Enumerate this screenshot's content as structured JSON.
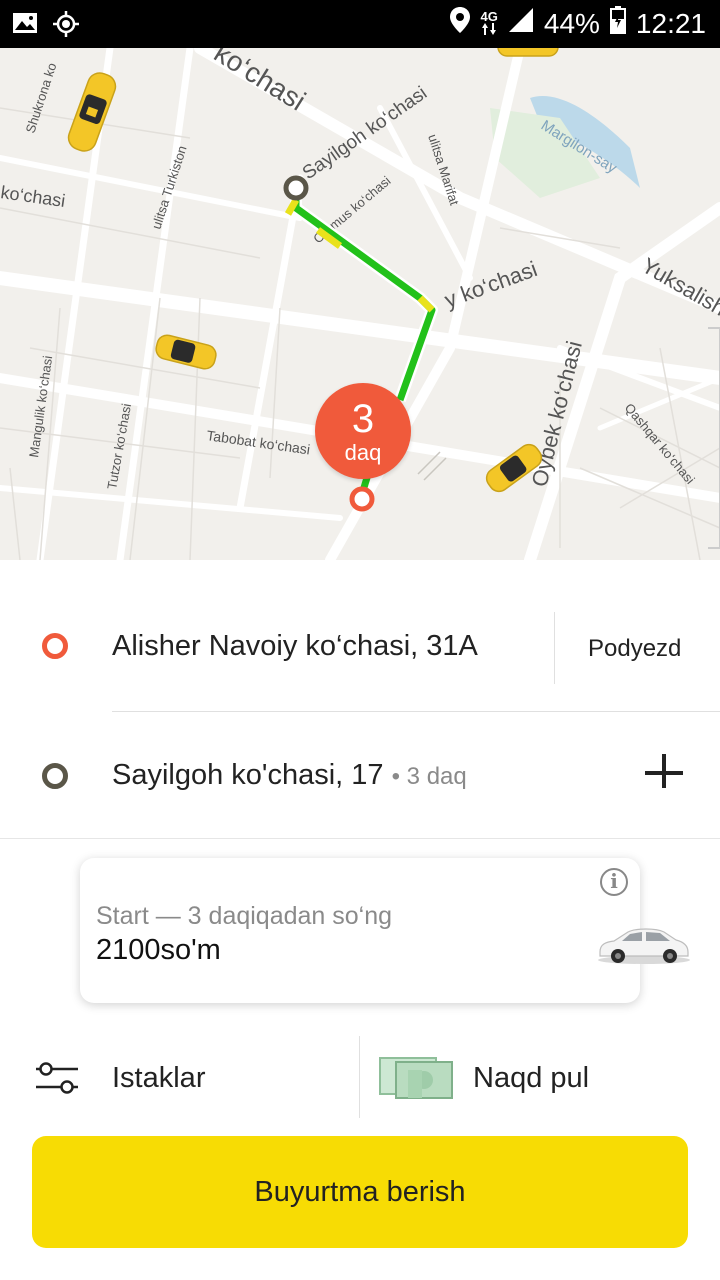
{
  "status_bar": {
    "network": "4G",
    "battery": "44%",
    "time": "12:21",
    "icons": [
      "image-icon",
      "gps-icon",
      "location-icon",
      "network-arrows-icon",
      "signal-icon",
      "battery-icon"
    ]
  },
  "map": {
    "streets": [
      "ko‘chasi",
      "Shukrona ko",
      "Sayilgoh ko‘chasi",
      "Margilon-say",
      "ulitsa Turkiston",
      "ko‘chasi",
      "Ommus ko‘chasi",
      "ulitsa Marifat",
      "y ko‘chasi",
      "Yuksalish",
      "Mangulik ko‘chasi",
      "Tutzor ko‘chasi",
      "Tabobat ko‘chasi",
      "Oybek ko‘chasi",
      "Qashqar ko‘chasi"
    ],
    "eta_value": "3",
    "eta_unit": "daq",
    "route_color": "#22c11a",
    "taxi_color": "#f3c627"
  },
  "pickup": {
    "address": "Alisher Navoiy ko‘chasi, 31A",
    "entrance_label": "Podyezd"
  },
  "destination": {
    "address": "Sayilgoh ko'chasi, 17",
    "eta": "• 3 daq"
  },
  "tariff": {
    "title": "Start — 3 daqiqadan so‘ng",
    "price": "2100so'm"
  },
  "options": {
    "wishes_label": "Istaklar",
    "payment_label": "Naqd pul"
  },
  "order_button": "Buyurtma berish",
  "colors": {
    "accent": "#f7dc04",
    "pickup": "#f05a3b",
    "destination": "#5a5648"
  }
}
